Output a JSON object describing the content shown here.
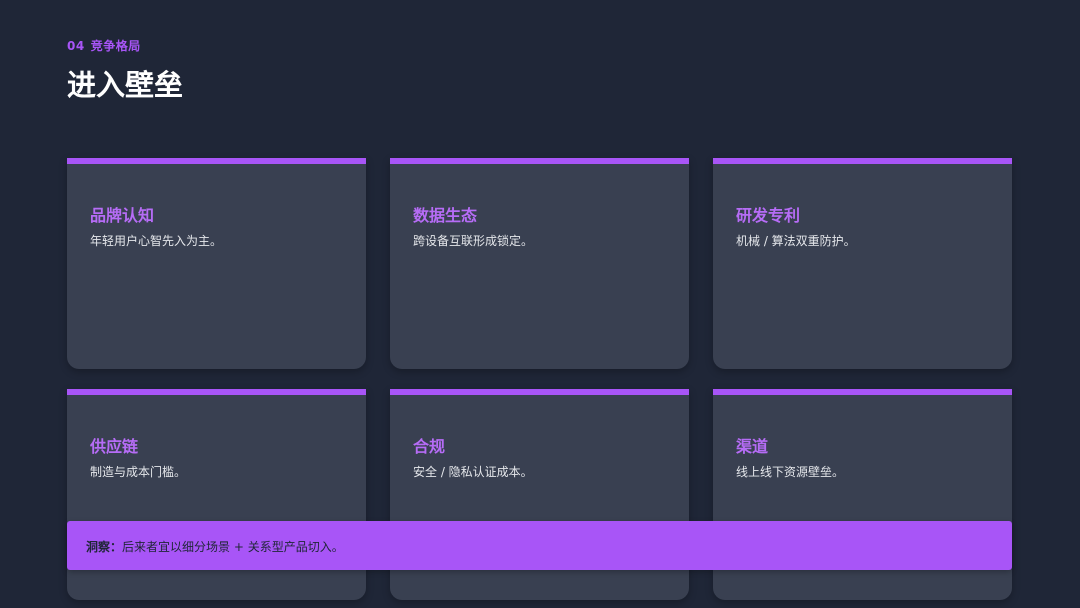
{
  "header": {
    "section_number": "04",
    "section_name": "竞争格局",
    "title": "进入壁垒"
  },
  "cards": [
    {
      "title": "品牌认知",
      "desc": "年轻用户心智先入为主。"
    },
    {
      "title": "数据生态",
      "desc": "跨设备互联形成锁定。"
    },
    {
      "title": "研发专利",
      "desc": "机械 / 算法双重防护。"
    },
    {
      "title": "供应链",
      "desc": "制造与成本门槛。"
    },
    {
      "title": "合规",
      "desc": "安全 / 隐私认证成本。"
    },
    {
      "title": "渠道",
      "desc": "线上线下资源壁垒。"
    }
  ],
  "insight": {
    "label": "洞察：",
    "text": "后来者宜以细分场景 + 关系型产品切入。"
  },
  "colors": {
    "background": "#1f2637",
    "card": "#394051",
    "accent": "#a855f7"
  }
}
